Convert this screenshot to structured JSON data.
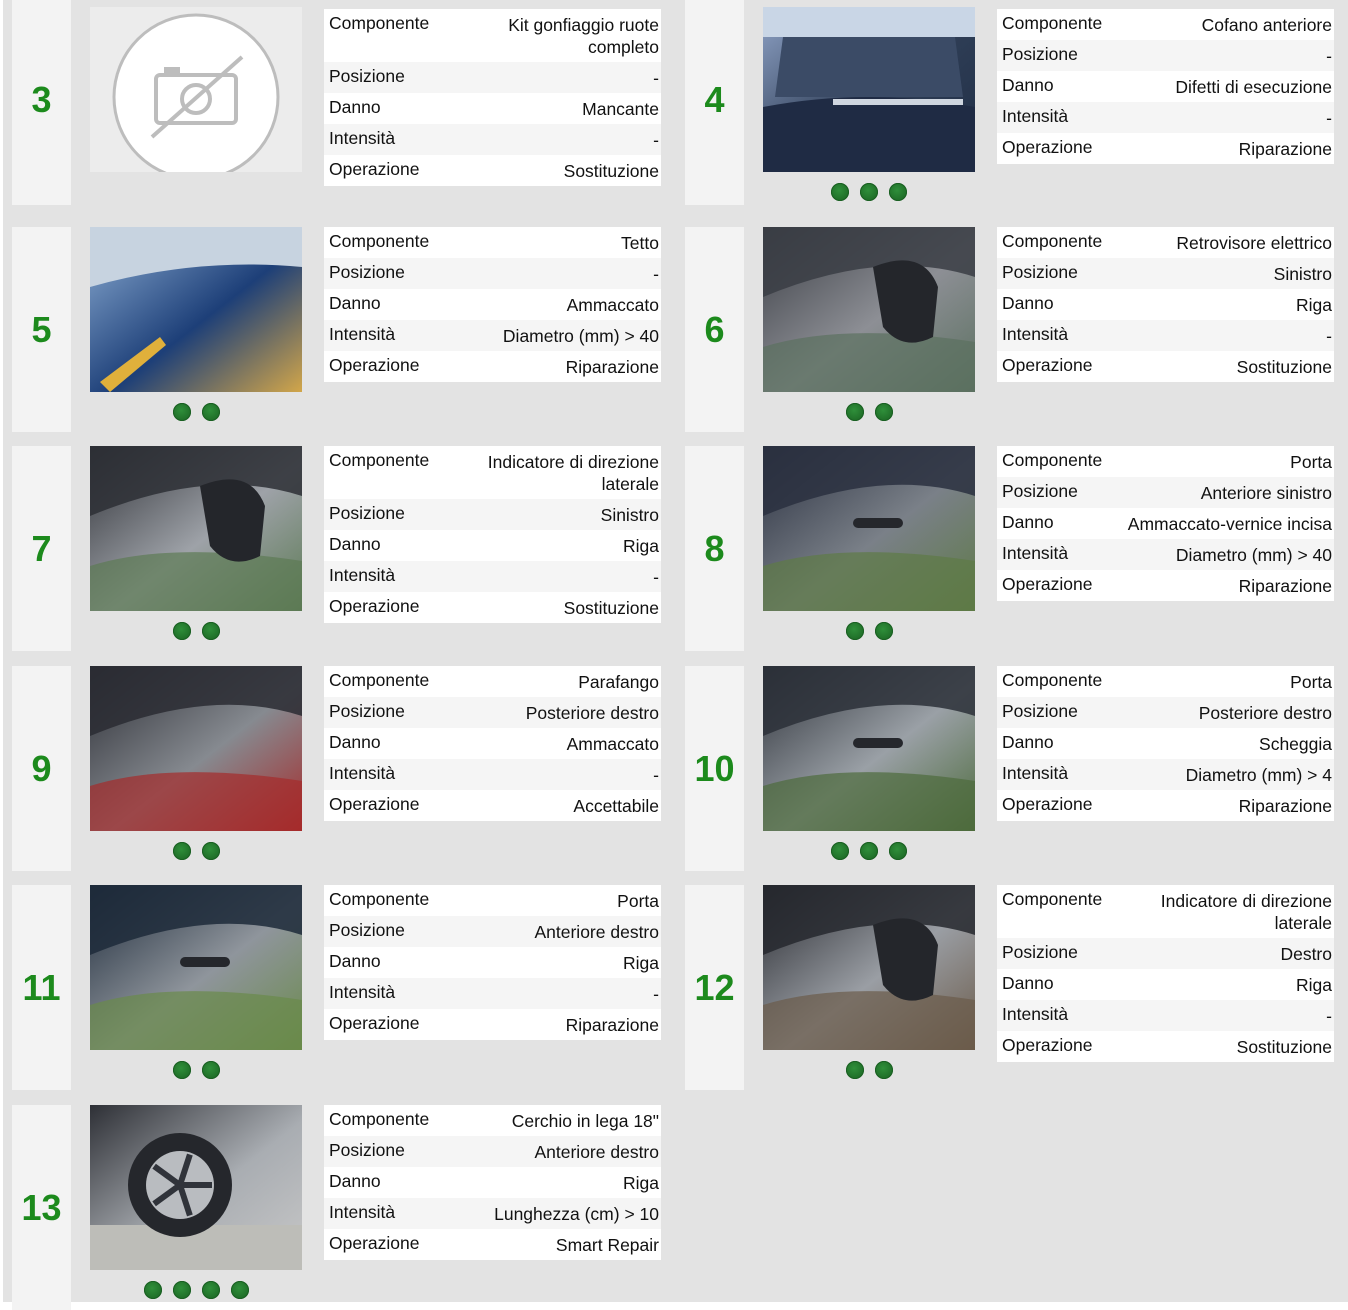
{
  "labels": {
    "componente": "Componente",
    "posizione": "Posizione",
    "danno": "Danno",
    "intensita": "Intensità",
    "operazione": "Operazione"
  },
  "colors": {
    "number": "#1c8a1c",
    "dot": "#1f6e28",
    "background": "#e3e3e3"
  },
  "cards": [
    {
      "num": "3",
      "photo": "no-photo-icon",
      "dots": 0,
      "componente": "Kit gonfiaggio ruote completo",
      "posizione": "-",
      "danno": "Mancante",
      "intensita": "-",
      "operazione": "Sostituzione"
    },
    {
      "num": "4",
      "photo": "car-hood-photo",
      "dots": 3,
      "componente": "Cofano anteriore",
      "posizione": "-",
      "danno": "Difetti di esecuzione",
      "intensita": "-",
      "operazione": "Riparazione"
    },
    {
      "num": "5",
      "photo": "car-roof-photo",
      "dots": 2,
      "componente": "Tetto",
      "posizione": "-",
      "danno": "Ammaccato",
      "intensita": "Diametro (mm) > 40",
      "operazione": "Riparazione"
    },
    {
      "num": "6",
      "photo": "side-mirror-photo",
      "dots": 2,
      "componente": "Retrovisore elettrico",
      "posizione": "Sinistro",
      "danno": "Riga",
      "intensita": "-",
      "operazione": "Sostituzione"
    },
    {
      "num": "7",
      "photo": "turn-indicator-photo",
      "dots": 2,
      "componente": "Indicatore di direzione laterale",
      "posizione": "Sinistro",
      "danno": "Riga",
      "intensita": "-",
      "operazione": "Sostituzione"
    },
    {
      "num": "8",
      "photo": "front-door-photo",
      "dots": 2,
      "componente": "Porta",
      "posizione": "Anteriore sinistro",
      "danno": "Ammaccato-vernice incisa",
      "intensita": "Diametro (mm) > 40",
      "operazione": "Riparazione"
    },
    {
      "num": "9",
      "photo": "rear-fender-photo",
      "dots": 2,
      "componente": "Parafango",
      "posizione": "Posteriore destro",
      "danno": "Ammaccato",
      "intensita": "-",
      "operazione": "Accettabile"
    },
    {
      "num": "10",
      "photo": "rear-door-photo",
      "dots": 3,
      "componente": "Porta",
      "posizione": "Posteriore destro",
      "danno": "Scheggia",
      "intensita": "Diametro (mm) > 4",
      "operazione": "Riparazione"
    },
    {
      "num": "11",
      "photo": "front-door-handle-photo",
      "dots": 2,
      "componente": "Porta",
      "posizione": "Anteriore destro",
      "danno": "Riga",
      "intensita": "-",
      "operazione": "Riparazione"
    },
    {
      "num": "12",
      "photo": "right-mirror-photo",
      "dots": 2,
      "componente": "Indicatore di direzione laterale",
      "posizione": "Destro",
      "danno": "Riga",
      "intensita": "-",
      "operazione": "Sostituzione"
    },
    {
      "num": "13",
      "photo": "alloy-wheel-photo",
      "dots": 4,
      "componente": "Cerchio in lega 18\"",
      "posizione": "Anteriore destro",
      "danno": "Riga",
      "intensita": "Lunghezza (cm) > 10",
      "operazione": "Smart Repair"
    }
  ]
}
